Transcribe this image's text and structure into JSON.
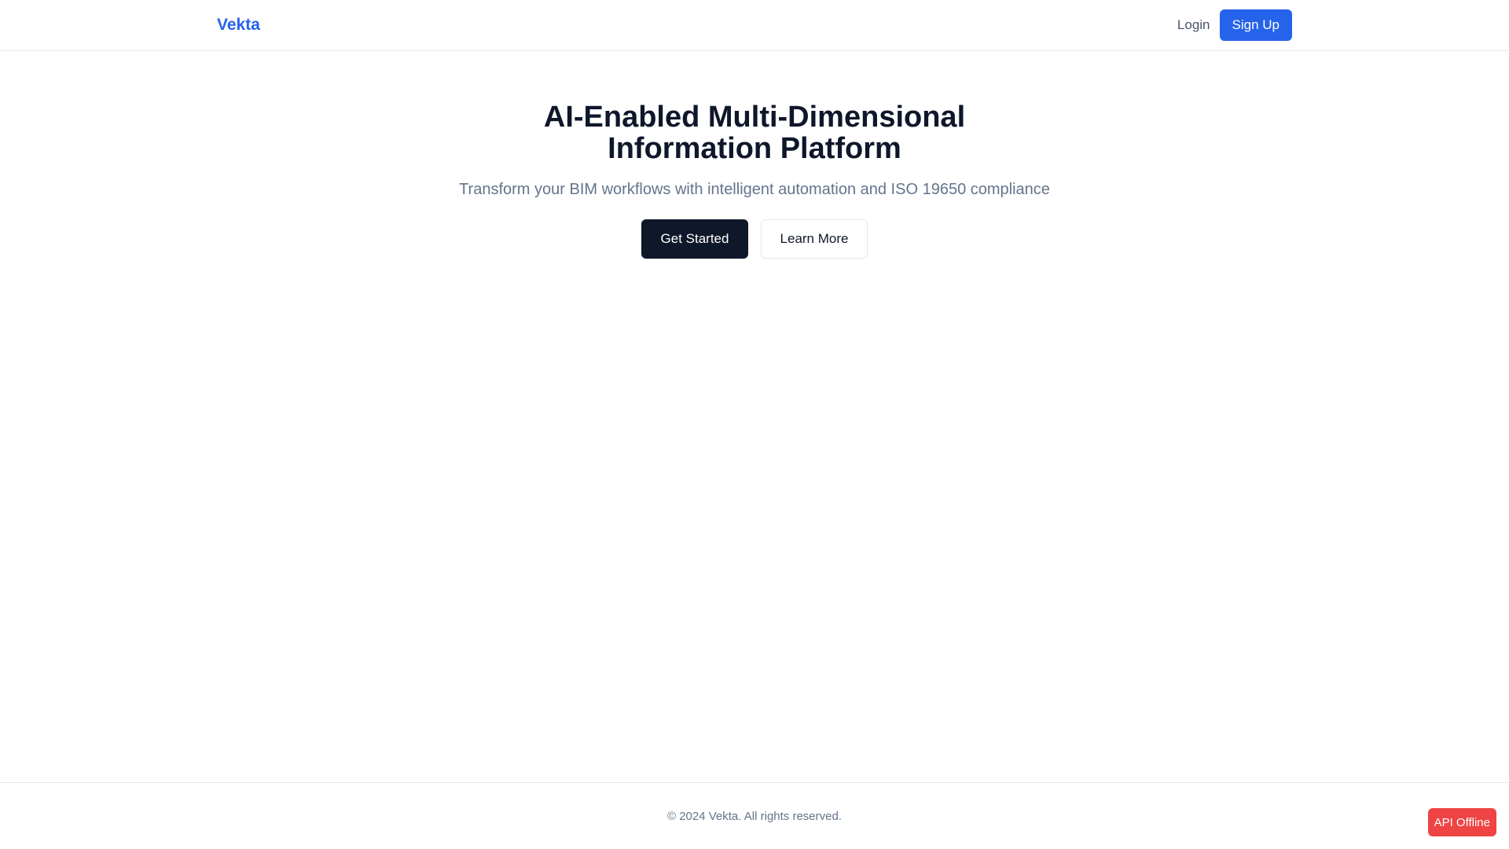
{
  "header": {
    "brand": "Vekta",
    "login_label": "Login",
    "signup_label": "Sign Up"
  },
  "hero": {
    "title": "AI-Enabled Multi-Dimensional Information Platform",
    "subtitle": "Transform your BIM workflows with intelligent automation and ISO 19650 compliance",
    "primary_label": "Get Started",
    "secondary_label": "Learn More"
  },
  "footer": {
    "copyright": "© 2024 Vekta. All rights reserved."
  },
  "status": {
    "api_label": "API Offline",
    "api_color": "#ef4444"
  },
  "colors": {
    "accent": "#2563eb",
    "dark": "#0f172a",
    "muted": "#64748b"
  }
}
